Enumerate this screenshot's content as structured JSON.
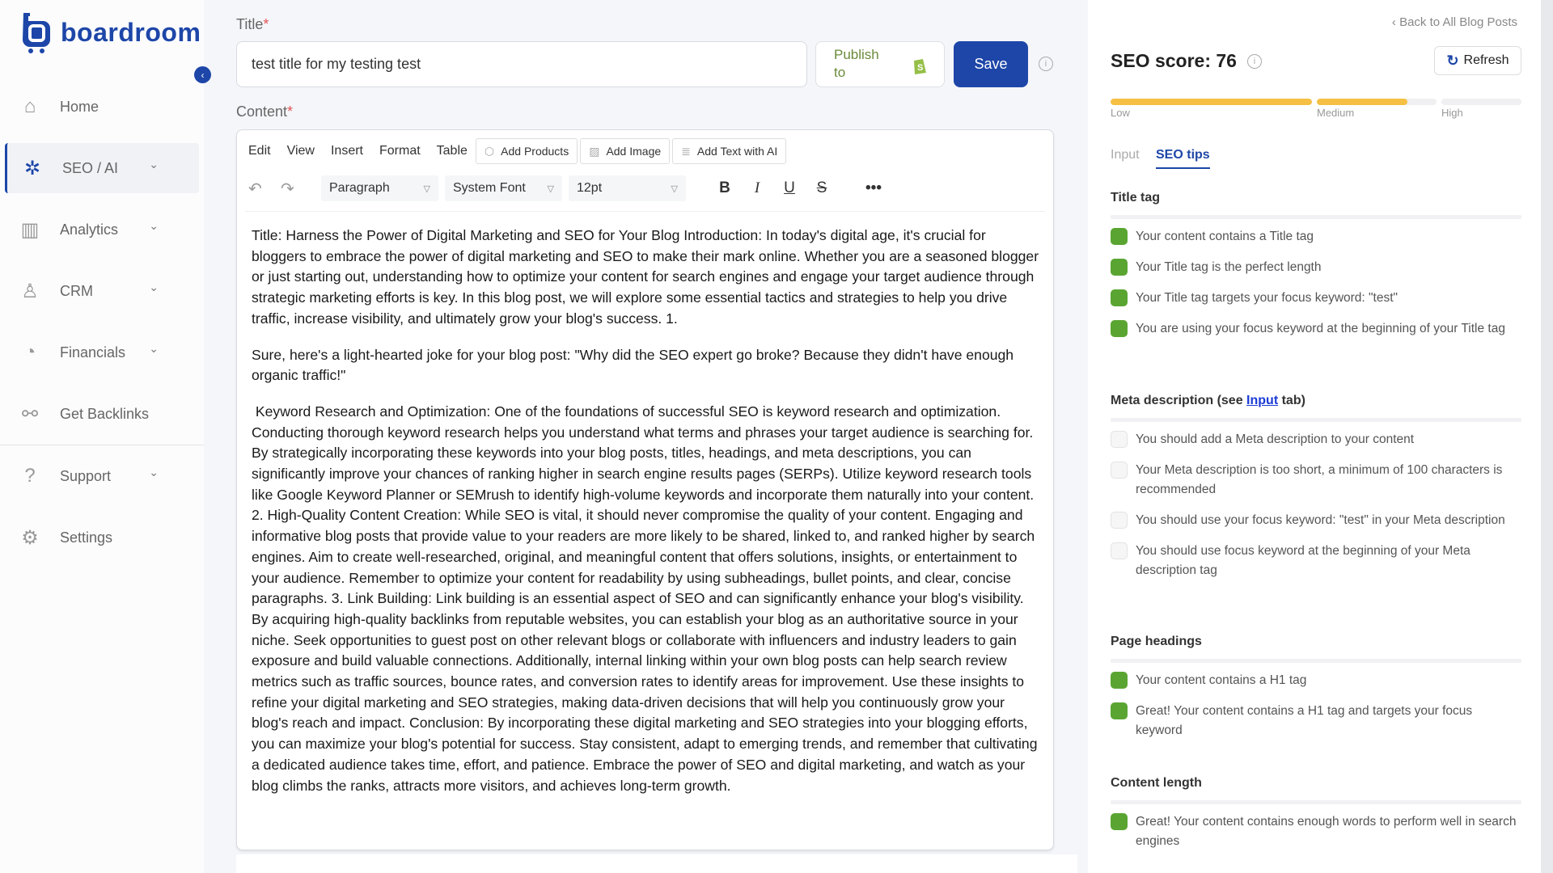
{
  "brand": {
    "name": "boardroom"
  },
  "sidebar": {
    "items": [
      {
        "label": "Home",
        "icon": "home-icon",
        "expandable": false
      },
      {
        "label": "SEO / AI",
        "icon": "network-icon",
        "expandable": true,
        "active": true
      },
      {
        "label": "Analytics",
        "icon": "bar-chart-icon",
        "expandable": true
      },
      {
        "label": "CRM",
        "icon": "user-icon",
        "expandable": true
      },
      {
        "label": "Financials",
        "icon": "growth-chart-icon",
        "expandable": true
      },
      {
        "label": "Get Backlinks",
        "icon": "link-icon",
        "expandable": false
      },
      {
        "label": "Support",
        "icon": "help-icon",
        "expandable": true
      },
      {
        "label": "Settings",
        "icon": "gear-icon",
        "expandable": false
      }
    ]
  },
  "form": {
    "title_label": "Title",
    "content_label": "Content",
    "required": "*",
    "title_value": "test title for my testing test",
    "publish_label": "Publish to",
    "save_label": "Save"
  },
  "editor": {
    "menu": [
      "Edit",
      "View",
      "Insert",
      "Format",
      "Table"
    ],
    "buttons": [
      "Add Products",
      "Add Image",
      "Add Text with AI"
    ],
    "block": "Paragraph",
    "font": "System Font",
    "size": "12pt",
    "paragraphs": [
      "Title: Harness the Power of Digital Marketing and SEO for Your Blog Introduction: In today's digital age, it's crucial for bloggers to embrace the power of digital marketing and SEO to make their mark online. Whether you are a seasoned blogger or just starting out, understanding how to optimize your content for search engines and engage your target audience through strategic marketing efforts is key. In this blog post, we will explore some essential tactics and strategies to help you drive traffic, increase visibility, and ultimately grow your blog's success. 1.",
      "Sure, here's a light-hearted joke for your blog post: \"Why did the SEO expert go broke? Because they didn't have enough organic traffic!\"",
      " Keyword Research and Optimization: One of the foundations of successful SEO is keyword research and optimization. Conducting thorough keyword research helps you understand what terms and phrases your target audience is searching for. By strategically incorporating these keywords into your blog posts, titles, headings, and meta descriptions, you can significantly improve your chances of ranking higher in search engine results pages (SERPs). Utilize keyword research tools like Google Keyword Planner or SEMrush to identify high-volume keywords and incorporate them naturally into your content. 2. High-Quality Content Creation: While SEO is vital, it should never compromise the quality of your content. Engaging and informative blog posts that provide value to your readers are more likely to be shared, linked to, and ranked higher by search engines. Aim to create well-researched, original, and meaningful content that offers solutions, insights, or entertainment to your audience. Remember to optimize your content for readability by using subheadings, bullet points, and clear, concise paragraphs. 3. Link Building: Link building is an essential aspect of SEO and can significantly enhance your blog's visibility. By acquiring high-quality backlinks from reputable websites, you can establish your blog as an authoritative source in your niche. Seek opportunities to guest post on other relevant blogs or collaborate with influencers and industry leaders to gain exposure and build valuable connections. Additionally, internal linking within your own blog posts can help search review metrics such as traffic sources, bounce rates, and conversion rates to identify areas for improvement. Use these insights to refine your digital marketing and SEO strategies, making data-driven decisions that will help you continuously grow your blog's reach and impact. Conclusion: By incorporating these digital marketing and SEO strategies into your blogging efforts, you can maximize your blog's potential for success. Stay consistent, adapt to emerging trends, and remember that cultivating a dedicated audience takes time, effort, and patience. Embrace the power of SEO and digital marketing, and watch as your blog climbs the ranks, attracts more visitors, and achieves long-term growth."
    ]
  },
  "seo": {
    "back_link": "‹ Back to All Blog Posts",
    "score_label": "SEO score: 76",
    "score": 76,
    "refresh_label": "Refresh",
    "levels": [
      {
        "label": "Low",
        "fill": 1.0
      },
      {
        "label": "Medium",
        "fill": 0.76
      },
      {
        "label": "High",
        "fill": 0
      }
    ],
    "bar_color": "#f5c044",
    "tabs": [
      {
        "label": "Input",
        "active": false
      },
      {
        "label": "SEO tips",
        "active": true
      }
    ],
    "sections": [
      {
        "title": "Title tag",
        "tips": [
          {
            "text": "Your content contains a Title tag",
            "ok": true
          },
          {
            "text": "Your Title tag is the perfect length",
            "ok": true
          },
          {
            "text": "Your Title tag targets your focus keyword: \"test\"",
            "ok": true
          },
          {
            "text": "You are using your focus keyword at the beginning of your Title tag",
            "ok": true
          }
        ]
      },
      {
        "title": "Meta description (see ",
        "link": "Input",
        "title_after": " tab)",
        "tips": [
          {
            "text": "You should add a Meta description to your content",
            "ok": false
          },
          {
            "text": "Your Meta description is too short, a minimum of 100 characters is recommended",
            "ok": false
          },
          {
            "text": "You should use your focus keyword: \"test\" in your Meta description",
            "ok": false
          },
          {
            "text": "You should use focus keyword at the beginning of your Meta description tag",
            "ok": false
          }
        ]
      },
      {
        "title": "Page headings",
        "tips": [
          {
            "text": "Your content contains a H1 tag",
            "ok": true
          },
          {
            "text": "Great! Your content contains a H1 tag and targets your focus keyword",
            "ok": true
          }
        ]
      },
      {
        "title": "Content length",
        "tips": [
          {
            "text": "Great! Your content contains enough words to perform well in search engines",
            "ok": true
          }
        ]
      }
    ]
  }
}
